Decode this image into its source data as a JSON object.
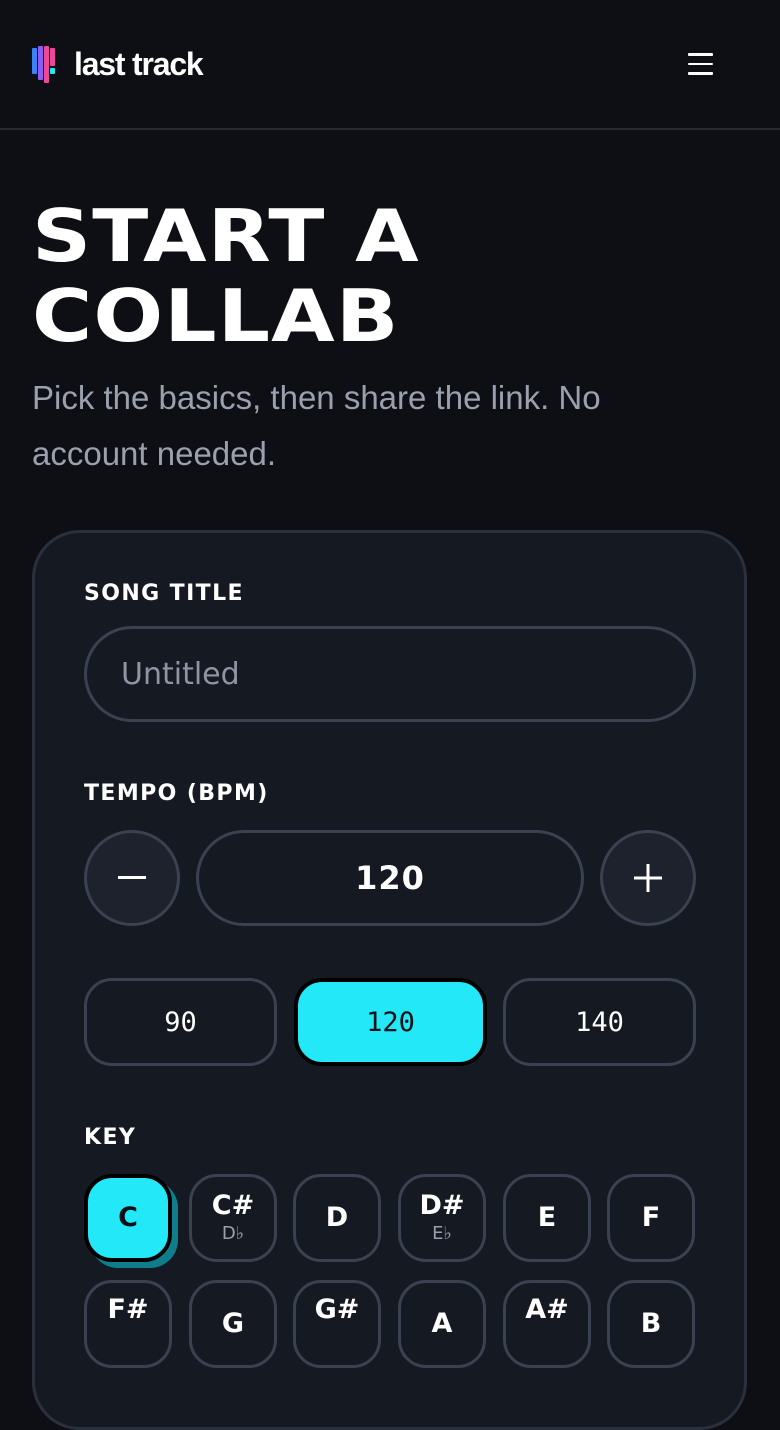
{
  "header": {
    "logo_text": "last track",
    "logo_colors": [
      "#3b82f6",
      "#8b5cf6",
      "#ec4899",
      "#22e8f8"
    ],
    "menu_icon": "hamburger-menu-icon"
  },
  "hero": {
    "title_line1": "START A",
    "title_line2": "COLLAB",
    "subtitle": "Pick the basics, then share the link. No account needed."
  },
  "form": {
    "song_title": {
      "label": "SONG TITLE",
      "placeholder": "Untitled",
      "value": ""
    },
    "tempo": {
      "label": "TEMPO (BPM)",
      "value": "120",
      "decrement_icon": "minus-icon",
      "increment_icon": "plus-icon",
      "presets": [
        "90",
        "120",
        "140"
      ],
      "selected_preset": "120"
    },
    "key": {
      "label": "KEY",
      "selected": "C",
      "row1": [
        {
          "main": "C",
          "alt": ""
        },
        {
          "main": "C#",
          "alt": "D♭"
        },
        {
          "main": "D",
          "alt": ""
        },
        {
          "main": "D#",
          "alt": "E♭"
        },
        {
          "main": "E",
          "alt": ""
        },
        {
          "main": "F",
          "alt": ""
        }
      ],
      "row2": [
        {
          "main": "F#",
          "alt": ""
        },
        {
          "main": "G",
          "alt": ""
        },
        {
          "main": "G#",
          "alt": ""
        },
        {
          "main": "A",
          "alt": ""
        },
        {
          "main": "A#",
          "alt": ""
        },
        {
          "main": "B",
          "alt": ""
        }
      ]
    }
  },
  "colors": {
    "accent": "#22e8f8",
    "background": "#0d0f14",
    "card": "#151922",
    "border": "#3a4150",
    "muted_text": "#9aa0ad"
  }
}
